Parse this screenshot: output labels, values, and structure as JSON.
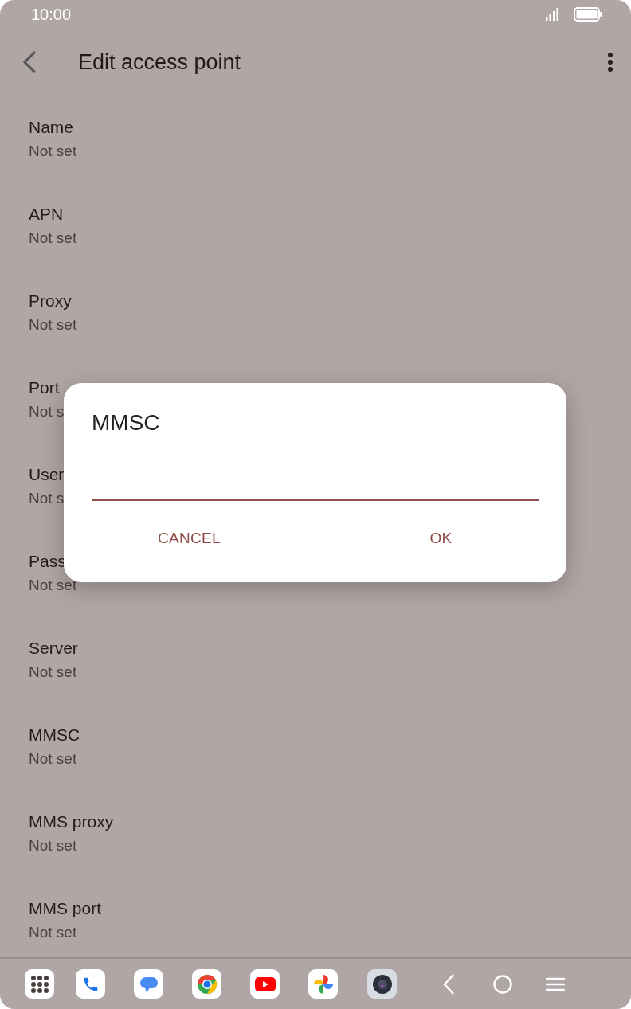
{
  "status_bar": {
    "time": "10:00"
  },
  "app_bar": {
    "title": "Edit access point"
  },
  "settings": [
    {
      "label": "Name",
      "value": "Not set"
    },
    {
      "label": "APN",
      "value": "Not set"
    },
    {
      "label": "Proxy",
      "value": "Not set"
    },
    {
      "label": "Port",
      "value": "Not s"
    },
    {
      "label": "User",
      "value": "Not s"
    },
    {
      "label": "Pass",
      "value": "Not set"
    },
    {
      "label": "Server",
      "value": "Not set"
    },
    {
      "label": "MMSC",
      "value": "Not set"
    },
    {
      "label": "MMS proxy",
      "value": "Not set"
    },
    {
      "label": "MMS port",
      "value": "Not set"
    }
  ],
  "dialog": {
    "title": "MMSC",
    "buttons": [
      "CANCEL",
      "OK"
    ]
  }
}
